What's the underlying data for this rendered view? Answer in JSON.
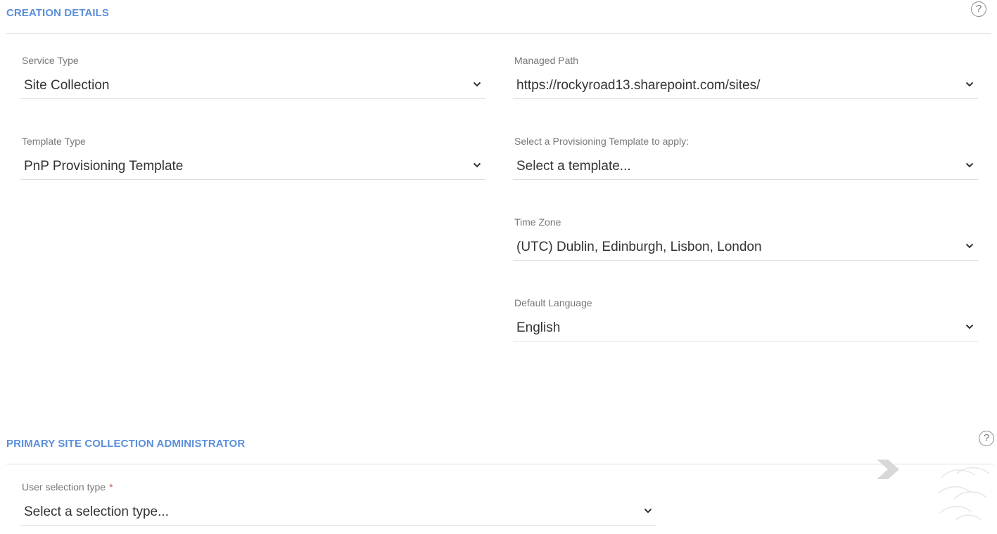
{
  "creation_details": {
    "title": "CREATION DETAILS",
    "help_icon": "question-circle-icon",
    "help_glyph": "?",
    "fields": {
      "service_type": {
        "label": "Service Type",
        "value": "Site Collection"
      },
      "managed_path": {
        "label": "Managed Path",
        "value": "https://rockyroad13.sharepoint.com/sites/"
      },
      "template_type": {
        "label": "Template Type",
        "value": "PnP Provisioning Template"
      },
      "provisioning_template": {
        "label": "Select a Provisioning Template to apply:",
        "value": "Select a template..."
      },
      "time_zone": {
        "label": "Time Zone",
        "value": "(UTC) Dublin, Edinburgh, Lisbon, London"
      },
      "default_language": {
        "label": "Default Language",
        "value": "English"
      }
    }
  },
  "primary_admin": {
    "title": "PRIMARY SITE COLLECTION ADMINISTRATOR",
    "help_icon": "question-circle-icon",
    "help_glyph": "?",
    "fields": {
      "user_selection_type": {
        "label": "User selection type",
        "required_marker": "*",
        "value": "Select a selection type..."
      }
    }
  },
  "icons": {
    "dropdown": "chevron-down-icon"
  },
  "colors": {
    "section_title": "#5b8fd9",
    "label": "#777777",
    "value": "#333333",
    "required": "#d9534f",
    "divider": "#e3e3e3"
  }
}
